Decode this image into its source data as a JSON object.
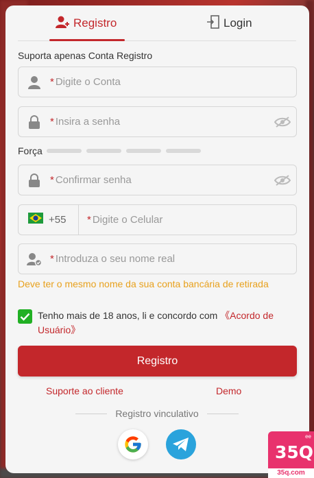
{
  "tabs": {
    "register": "Registro",
    "login": "Login"
  },
  "hint": "Suporta apenas Conta Registro",
  "fields": {
    "account": {
      "star": "*",
      "placeholder": "Digite o Conta"
    },
    "password": {
      "star": "*",
      "placeholder": "Insira a senha"
    },
    "confirm": {
      "star": "*",
      "placeholder": "Confirmar senha"
    },
    "phone": {
      "prefix": "+55",
      "star": "*",
      "placeholder": "Digite o Celular"
    },
    "realname": {
      "star": "*",
      "placeholder": "Introduza o seu nome real"
    }
  },
  "strength_label": "Força",
  "warning": "Deve ter o mesmo nome da sua conta bancária de retirada",
  "agreement": {
    "text": "Tenho mais de 18 anos, li e concordo com ",
    "link": "《Acordo de Usuário》"
  },
  "submit_label": "Registro",
  "links": {
    "support": "Suporte ao cliente",
    "demo": "Demo"
  },
  "divider_text": "Registro vinculativo",
  "brand": {
    "name": "35Q",
    "domain": "35q.com",
    "corner": "ee"
  },
  "colors": {
    "accent": "#c3272b",
    "warning": "#e8a11d",
    "check": "#21b024",
    "brand": "#e8326d"
  }
}
